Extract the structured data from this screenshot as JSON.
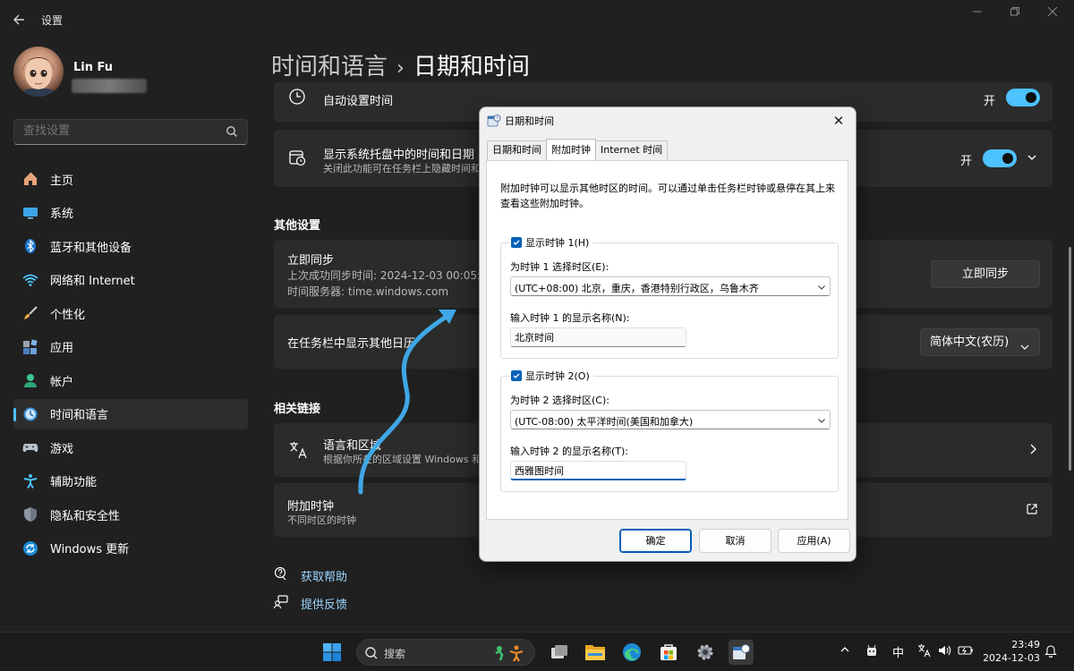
{
  "window": {
    "title": "设置"
  },
  "profile": {
    "name": "Lin Fu"
  },
  "search": {
    "placeholder": "查找设置"
  },
  "nav": [
    {
      "label": "主页",
      "icon": "home-icon"
    },
    {
      "label": "系统",
      "icon": "system-icon"
    },
    {
      "label": "蓝牙和其他设备",
      "icon": "bluetooth-icon"
    },
    {
      "label": "网络和 Internet",
      "icon": "wifi-icon"
    },
    {
      "label": "个性化",
      "icon": "brush-icon"
    },
    {
      "label": "应用",
      "icon": "apps-icon"
    },
    {
      "label": "帐户",
      "icon": "account-icon"
    },
    {
      "label": "时间和语言",
      "icon": "time-language-icon",
      "active": true
    },
    {
      "label": "游戏",
      "icon": "gaming-icon"
    },
    {
      "label": "辅助功能",
      "icon": "accessibility-icon"
    },
    {
      "label": "隐私和安全性",
      "icon": "shield-icon"
    },
    {
      "label": "Windows 更新",
      "icon": "update-icon"
    }
  ],
  "breadcrumb": {
    "parent": "时间和语言",
    "separator": "›",
    "current": "日期和时间"
  },
  "settings": {
    "auto_time": {
      "title": "自动设置时间",
      "state": "开"
    },
    "tray_time": {
      "title": "显示系统托盘中的时间和日期",
      "subtitle": "关闭此功能可在任务栏上隐藏时间和日",
      "state": "开"
    },
    "other_heading": "其他设置",
    "sync": {
      "title": "立即同步",
      "last_sync": "上次成功同步时间: 2024-12-03 00:05:",
      "server": "时间服务器: time.windows.com",
      "button": "立即同步"
    },
    "calendar": {
      "title": "在任务栏中显示其他日历",
      "value": "简体中文(农历)"
    },
    "related_heading": "相关链接",
    "region": {
      "title": "语言和区域",
      "subtitle": "根据你所在的区域设置 Windows 和"
    },
    "clocks": {
      "title": "附加时钟",
      "subtitle": "不同时区的时钟"
    },
    "help": "获取帮助",
    "feedback": "提供反馈"
  },
  "dialog": {
    "title": "日期和时间",
    "tabs": [
      "日期和时间",
      "附加时钟",
      "Internet 时间"
    ],
    "active_tab": 1,
    "description": "附加时钟可以显示其他时区的时间。可以通过单击任务栏时钟或悬停在其上来查看这些附加时钟。",
    "clock1": {
      "checkbox_label": "显示时钟 1(H)",
      "checked": true,
      "timezone_label": "为时钟 1 选择时区(E):",
      "timezone": "(UTC+08:00) 北京，重庆，香港特别行政区，乌鲁木齐",
      "name_label": "输入时钟 1 的显示名称(N):",
      "name": "北京时间"
    },
    "clock2": {
      "checkbox_label": "显示时钟 2(O)",
      "checked": true,
      "timezone_label": "为时钟 2 选择时区(C):",
      "timezone": "(UTC-08:00) 太平洋时间(美国和加拿大)",
      "name_label": "输入时钟 2 的显示名称(T):",
      "name": "西雅图时间"
    },
    "buttons": {
      "ok": "确定",
      "cancel": "取消",
      "apply": "应用(A)"
    }
  },
  "taskbar": {
    "search_text": "搜索",
    "ime": "中",
    "time": "23:49",
    "date": "2024-12-03"
  },
  "colors": {
    "accent": "#4cc2ff",
    "background": "#202020",
    "card": "#2b2b2b",
    "dialog_accent": "#005fb8"
  }
}
